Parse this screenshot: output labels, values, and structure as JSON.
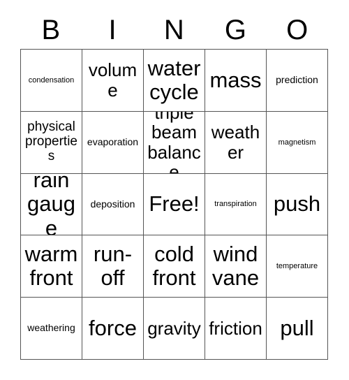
{
  "header": {
    "letters": [
      "B",
      "I",
      "N",
      "G",
      "O"
    ]
  },
  "grid": {
    "rows": 5,
    "columns": 5,
    "free_space_label": "Free!",
    "cells": [
      {
        "text": "condensation",
        "size": "fs-xs"
      },
      {
        "text": "volume",
        "size": "fs-xl"
      },
      {
        "text": "water cycle",
        "size": "fs-xxl"
      },
      {
        "text": "mass",
        "size": "fs-xxl"
      },
      {
        "text": "prediction",
        "size": "fs-sm"
      },
      {
        "text": "physical properties",
        "size": "fs-md"
      },
      {
        "text": "evaporation",
        "size": "fs-sm"
      },
      {
        "text": "triple beam balance",
        "size": "fs-xl"
      },
      {
        "text": "weather",
        "size": "fs-xl"
      },
      {
        "text": "magnetism",
        "size": "fs-xs"
      },
      {
        "text": "rain gauge",
        "size": "fs-xxl"
      },
      {
        "text": "deposition",
        "size": "fs-sm"
      },
      {
        "text": "Free!",
        "size": "fs-xxl"
      },
      {
        "text": "transpiration",
        "size": "fs-xs"
      },
      {
        "text": "push",
        "size": "fs-xxl"
      },
      {
        "text": "warm front",
        "size": "fs-xxl"
      },
      {
        "text": "run-off",
        "size": "fs-xxl"
      },
      {
        "text": "cold front",
        "size": "fs-xxl"
      },
      {
        "text": "wind vane",
        "size": "fs-xxl"
      },
      {
        "text": "temperature",
        "size": "fs-xs"
      },
      {
        "text": "weathering",
        "size": "fs-sm"
      },
      {
        "text": "force",
        "size": "fs-xxl"
      },
      {
        "text": "gravity",
        "size": "fs-xl"
      },
      {
        "text": "friction",
        "size": "fs-xl"
      },
      {
        "text": "pull",
        "size": "fs-xxl"
      }
    ]
  },
  "colors": {
    "background": "#ffffff",
    "text": "#000000",
    "border": "#555555"
  }
}
